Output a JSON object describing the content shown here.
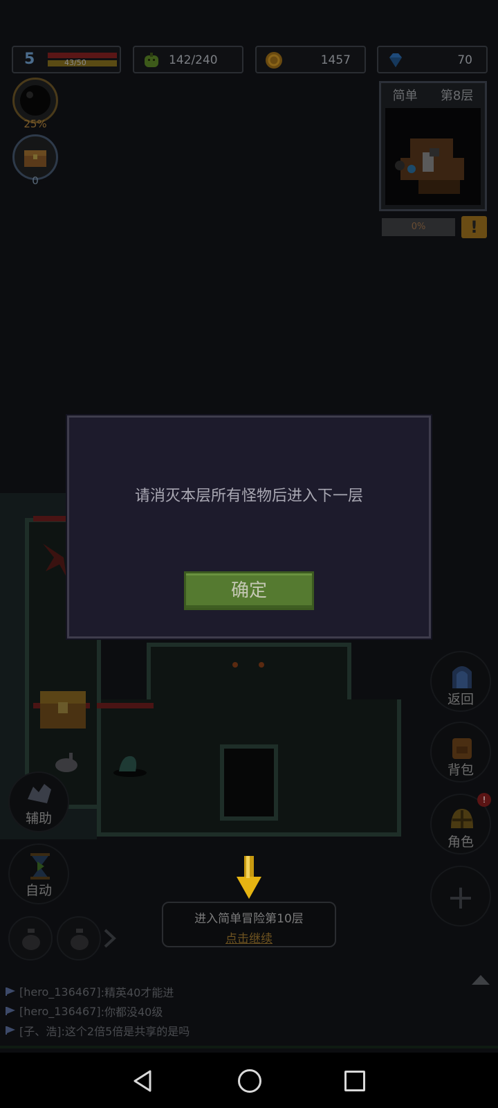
{
  "hud": {
    "level": "5",
    "hp": "43/50",
    "energy": "142/240",
    "gold": "1457",
    "gems": "70"
  },
  "badges": {
    "orb_percent": "25%",
    "chest_count": "0"
  },
  "minimap": {
    "difficulty": "简单",
    "floor": "第8层",
    "progress": "0%",
    "alert_icon": "!"
  },
  "side_buttons": {
    "back": "返回",
    "bag": "背包",
    "character": "角色",
    "add": "+"
  },
  "left_buttons": {
    "assist": "辅助",
    "auto": "自动"
  },
  "continue": {
    "title": "进入简单冒险第10层",
    "link": "点击继续"
  },
  "chat": [
    {
      "sender": "[hero_136467]",
      "text": ":精英40才能进"
    },
    {
      "sender": "[hero_136467]",
      "text": ":你都没40级"
    },
    {
      "sender": "[子、浩]",
      "text": ":这个2倍5倍是共享的是吗"
    }
  ],
  "dialog": {
    "message": "请消灭本层所有怪物后进入下一层",
    "confirm": "确定"
  },
  "colors": {
    "dialog_bg": "#1d1b2c",
    "confirm_green": "#557a30",
    "link_gold": "#6e5320"
  }
}
